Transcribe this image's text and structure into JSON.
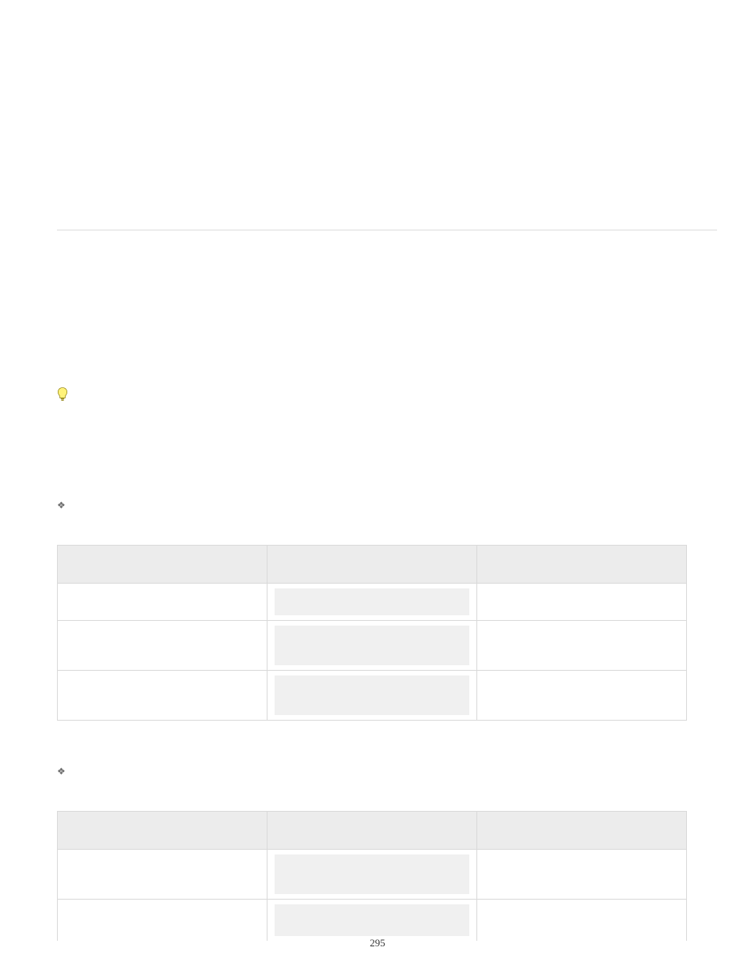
{
  "page_number": "295",
  "tip": {
    "text": ""
  },
  "section1": {
    "heading": "",
    "table": {
      "headers": [
        "",
        "",
        ""
      ],
      "rows": [
        {
          "col1": "",
          "code": "",
          "col3": ""
        },
        {
          "col1": "",
          "code": "",
          "col3": ""
        },
        {
          "col1": "",
          "code": "",
          "col3": ""
        }
      ]
    }
  },
  "section2": {
    "heading": "",
    "table": {
      "headers": [
        "",
        "",
        ""
      ],
      "rows": [
        {
          "col1": "",
          "code": "",
          "col3": ""
        },
        {
          "col1": "",
          "code": "",
          "col3": ""
        }
      ]
    }
  }
}
